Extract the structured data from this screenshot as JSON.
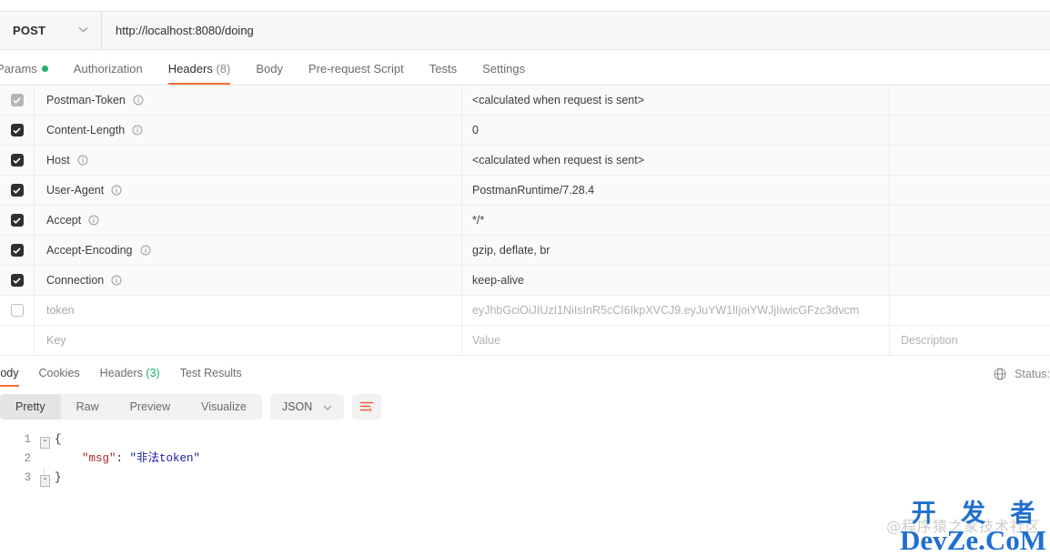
{
  "url_bar": {
    "method": "POST",
    "chevron": "chevron-down-icon",
    "url": "http://localhost:8080/doing"
  },
  "request_tabs": [
    {
      "label": "Params",
      "count": "",
      "dot": true,
      "active": false
    },
    {
      "label": "Authorization",
      "count": "",
      "dot": false,
      "active": false
    },
    {
      "label": "Headers",
      "count": "(8)",
      "dot": false,
      "active": true
    },
    {
      "label": "Body",
      "count": "",
      "dot": false,
      "active": false
    },
    {
      "label": "Pre-request Script",
      "count": "",
      "dot": false,
      "active": false
    },
    {
      "label": "Tests",
      "count": "",
      "dot": false,
      "active": false
    },
    {
      "label": "Settings",
      "count": "",
      "dot": false,
      "active": false
    }
  ],
  "headers_table": {
    "columns": {
      "key": "Key",
      "value": "Value",
      "description": "Description"
    },
    "rows": [
      {
        "checkbox": "disabled",
        "key": "Postman-Token",
        "info": true,
        "value": "<calculated when request is sent>",
        "muted": false
      },
      {
        "checkbox": "checked",
        "key": "Content-Length",
        "info": true,
        "value": "0",
        "muted": false
      },
      {
        "checkbox": "checked",
        "key": "Host",
        "info": true,
        "value": "<calculated when request is sent>",
        "muted": false
      },
      {
        "checkbox": "checked",
        "key": "User-Agent",
        "info": true,
        "value": "PostmanRuntime/7.28.4",
        "muted": false
      },
      {
        "checkbox": "checked",
        "key": "Accept",
        "info": true,
        "value": "*/*",
        "muted": false
      },
      {
        "checkbox": "checked",
        "key": "Accept-Encoding",
        "info": true,
        "value": "gzip, deflate, br",
        "muted": false
      },
      {
        "checkbox": "checked",
        "key": "Connection",
        "info": true,
        "value": "keep-alive",
        "muted": false
      },
      {
        "checkbox": "empty",
        "key": "token",
        "info": false,
        "value": "eyJhbGciOiJIUzI1NiIsInR5cCI6IkpXVCJ9.eyJuYW1lIjoiYWJjIiwicGFzc3dvcm",
        "muted": true
      }
    ]
  },
  "response_tabs": [
    {
      "label": "Body",
      "count": "",
      "active": true
    },
    {
      "label": "Cookies",
      "count": "",
      "active": false
    },
    {
      "label": "Headers",
      "count": "(3)",
      "active": false
    },
    {
      "label": "Test Results",
      "count": "",
      "active": false
    }
  ],
  "status": {
    "globe_icon": "globe-icon",
    "label": "Status:"
  },
  "viewer": {
    "modes": [
      "Pretty",
      "Raw",
      "Preview",
      "Visualize"
    ],
    "active_mode": "Pretty",
    "format": "JSON",
    "format_chevron": "chevron-down-icon",
    "wrap_icon": "word-wrap-icon"
  },
  "response_body": {
    "line_numbers": [
      "1",
      "2",
      "3"
    ],
    "lines": [
      {
        "fold": "-",
        "segments": []
      },
      {
        "fold": "",
        "segments": [
          {
            "text": "    \"msg\"",
            "type": "key"
          },
          {
            "text": ": ",
            "type": "punct"
          },
          {
            "text": "\"非法token\"",
            "type": "string"
          }
        ]
      },
      {
        "fold": "-",
        "segments": []
      }
    ],
    "open_brace": "{",
    "close_brace": "}"
  },
  "watermark": {
    "chinese": "开 发 者",
    "english": "DevZe.CoM",
    "ghost": "@程序猿之家技术社区"
  },
  "colors": {
    "accent": "#ff6c37",
    "green": "#23b26d",
    "watermark_blue": "#1f6fd0"
  }
}
